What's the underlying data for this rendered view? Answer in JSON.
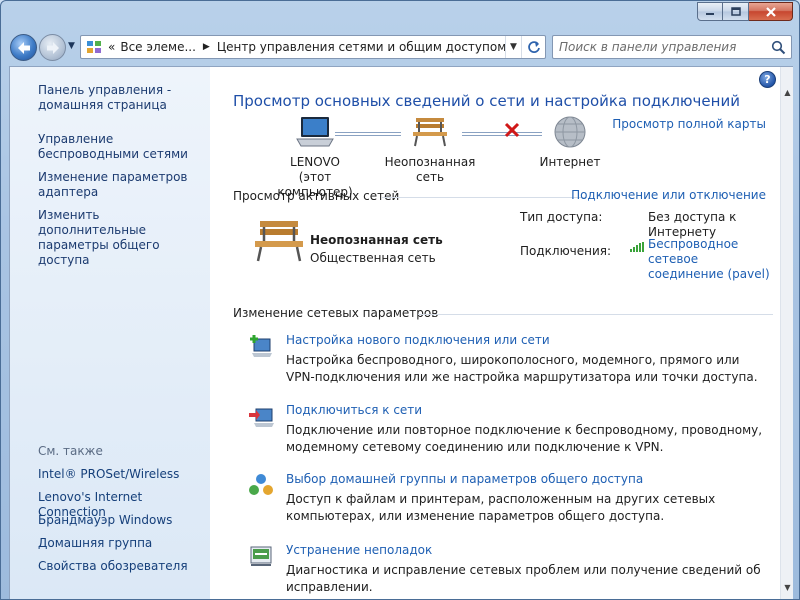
{
  "window": {
    "caption_buttons": {
      "minimize": "minimize-icon",
      "maximize": "maximize-icon",
      "close": "close-icon"
    }
  },
  "navbar": {
    "back_icon": "back-arrow-icon",
    "forward_icon": "forward-arrow-icon",
    "breadcrumb_overflow": "«",
    "breadcrumb": [
      "Все элеме...",
      "Центр управления сетями и общим доступом"
    ],
    "search_placeholder": "Поиск в панели управления"
  },
  "sidebar": {
    "links": [
      "Панель управления - домашняя страница",
      "Управление беспроводными сетями",
      "Изменение параметров адаптера",
      "Изменить дополнительные параметры общего доступа"
    ],
    "see_also_title": "См. также",
    "see_also": [
      "Intel® PROSet/Wireless",
      "Lenovo's Internet Connection",
      "Брандмауэр Windows",
      "Домашняя группа",
      "Свойства обозревателя"
    ]
  },
  "main": {
    "title": "Просмотр основных сведений о сети и настройка подключений",
    "full_map_link": "Просмотр полной карты",
    "map": {
      "computer_name": "LENOVO",
      "computer_sub": "(этот компьютер)",
      "network": "Неопознанная сеть",
      "internet": "Интернет"
    },
    "active_networks_header": "Просмотр активных сетей",
    "connect_disconnect_link": "Подключение или отключение",
    "active_network": {
      "name": "Неопознанная сеть",
      "category": "Общественная сеть",
      "access_type_label": "Тип доступа:",
      "access_type_value": "Без доступа к Интернету",
      "connections_label": "Подключения:",
      "connections_value": "Беспроводное сетевое соединение (pavel)"
    },
    "change_settings_header": "Изменение сетевых параметров",
    "tasks": [
      {
        "title": "Настройка нового подключения или сети",
        "desc": "Настройка беспроводного, широкополосного, модемного, прямого или VPN-подключения или же настройка маршрутизатора или точки доступа."
      },
      {
        "title": "Подключиться к сети",
        "desc": "Подключение или повторное подключение к беспроводному, проводному, модемному сетевому соединению или подключение к VPN."
      },
      {
        "title": "Выбор домашней группы и параметров общего доступа",
        "desc": "Доступ к файлам и принтерам, расположенным на других сетевых компьютерах, или изменение параметров общего доступа."
      },
      {
        "title": "Устранение неполадок",
        "desc": "Диагностика и исправление сетевых проблем или получение сведений об исправлении."
      }
    ]
  }
}
